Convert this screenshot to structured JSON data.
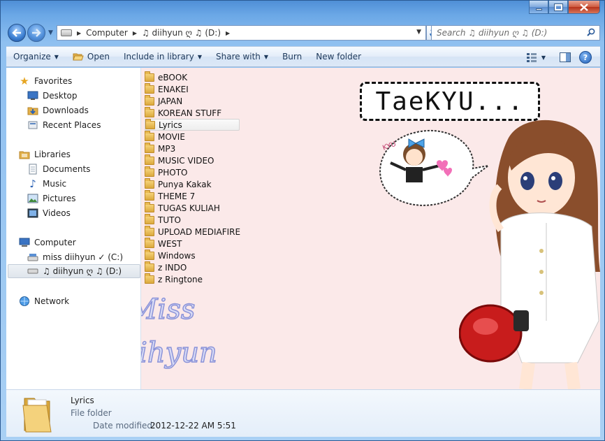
{
  "window": {
    "caption_minimize": "–",
    "caption_maximize": "□",
    "caption_close": "✕"
  },
  "nav": {
    "back_icon": "arrow-left-icon",
    "forward_icon": "arrow-right-icon",
    "breadcrumb": [
      "Computer",
      "♫ diihyun ღ ♫ (D:)"
    ],
    "search_placeholder": "Search ♫ diihyun ღ ♫ (D:)"
  },
  "commands": {
    "organize": "Organize",
    "open": "Open",
    "include_in_library": "Include in library",
    "share_with": "Share with",
    "burn": "Burn",
    "new_folder": "New folder"
  },
  "navpane": {
    "favorites": "Favorites",
    "desktop": "Desktop",
    "downloads": "Downloads",
    "recent_places": "Recent Places",
    "libraries": "Libraries",
    "documents": "Documents",
    "music": "Music",
    "pictures": "Pictures",
    "videos": "Videos",
    "computer": "Computer",
    "drive_c": "miss diihyun ✓ (C:)",
    "drive_d": "♫ diihyun ღ ♫ (D:)",
    "network": "Network"
  },
  "folders": [
    "eBOOK",
    "ENAKEI",
    "JAPAN",
    "KOREAN STUFF",
    "Lyrics",
    "MOVIE",
    "MP3",
    "MUSIC VIDEO",
    "PHOTO",
    "Punya Kakak",
    "THEME 7",
    "TUGAS KULIAH",
    "TUTO",
    "UPLOAD MEDIAFIRE",
    "WEST",
    "Windows",
    "z INDO",
    "z Ringtone"
  ],
  "selected_folder": "Lyrics",
  "background": {
    "sign_text": "TaeKYU...",
    "watermark_line1": "Miss",
    "watermark_line2": "Diihyun",
    "bubble_text": "KYU"
  },
  "details": {
    "name": "Lyrics",
    "type": "File folder",
    "date_label": "Date modified:",
    "date_value": "2012-12-22 AM 5:51"
  },
  "colors": {
    "content_bg": "#fbe9e9",
    "title_blue": "#6aa7e6",
    "command_text": "#1e395b"
  }
}
